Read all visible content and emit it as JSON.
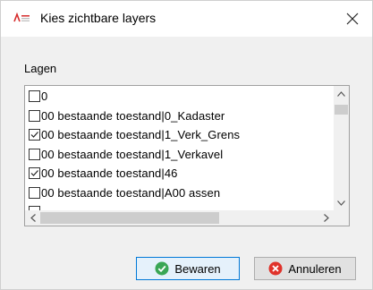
{
  "window": {
    "title": "Kies zichtbare layers",
    "app_icon": "app-logo-icon",
    "close_icon": "close-icon"
  },
  "group": {
    "label": "Lagen"
  },
  "layers": [
    {
      "label": "0",
      "checked": false
    },
    {
      "label": "00 bestaande toestand|0_Kadaster",
      "checked": false
    },
    {
      "label": "00 bestaande toestand|1_Verk_Grens",
      "checked": true
    },
    {
      "label": "00 bestaande toestand|1_Verkavel",
      "checked": false
    },
    {
      "label": "00 bestaande toestand|46",
      "checked": true
    },
    {
      "label": "00 bestaande toestand|A00 assen",
      "checked": false
    },
    {
      "label": "",
      "checked": false
    }
  ],
  "buttons": {
    "save_label": "Bewaren",
    "save_icon": "check-circle-icon",
    "cancel_label": "Annuleren",
    "cancel_icon": "x-circle-icon"
  },
  "colors": {
    "accent": "#0078d7",
    "save_icon": "#3aa655",
    "cancel_icon": "#e0322a"
  }
}
